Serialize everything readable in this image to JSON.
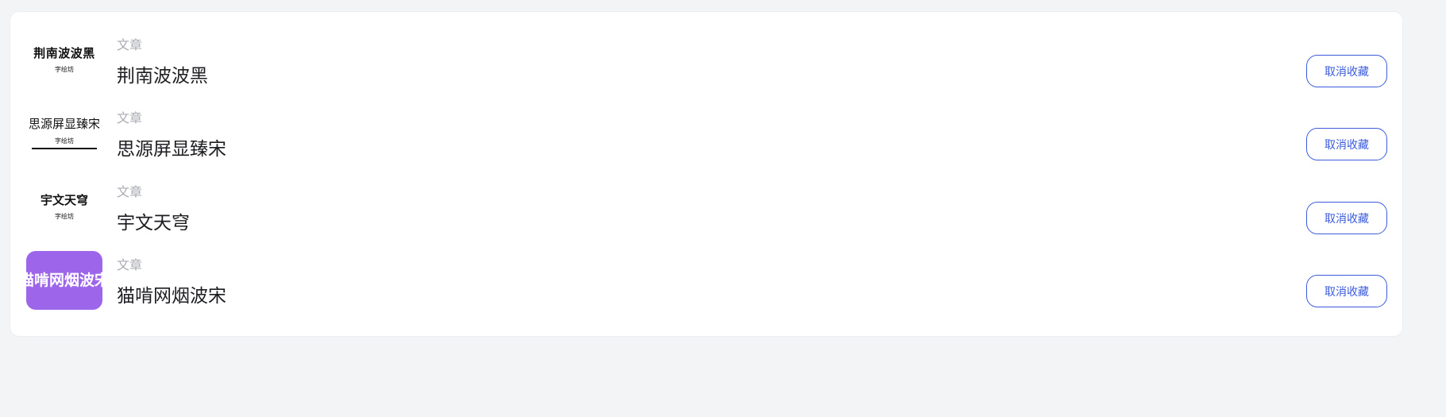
{
  "favorites": {
    "items": [
      {
        "thumb_text": "荆南波波黑",
        "thumb_sub": "字绘坊",
        "category": "文章",
        "title": "荆南波波黑",
        "action_label": "取消收藏"
      },
      {
        "thumb_text": "思源屏显臻宋",
        "thumb_sub": "字绘坊",
        "category": "文章",
        "title": "思源屏显臻宋",
        "action_label": "取消收藏"
      },
      {
        "thumb_text": "宇文天穹",
        "thumb_sub": "字绘坊",
        "category": "文章",
        "title": "宇文天穹",
        "action_label": "取消收藏"
      },
      {
        "thumb_text": "猫啃网烟波宋",
        "category": "文章",
        "title": "猫啃网烟波宋",
        "action_label": "取消收藏",
        "thumb_bg": "#9d65ea"
      }
    ]
  },
  "colors": {
    "page_bg": "#f3f4f6",
    "card_bg": "#ffffff",
    "accent": "#3b5bdb",
    "muted": "#a8abb1",
    "text": "#1c1d20"
  }
}
